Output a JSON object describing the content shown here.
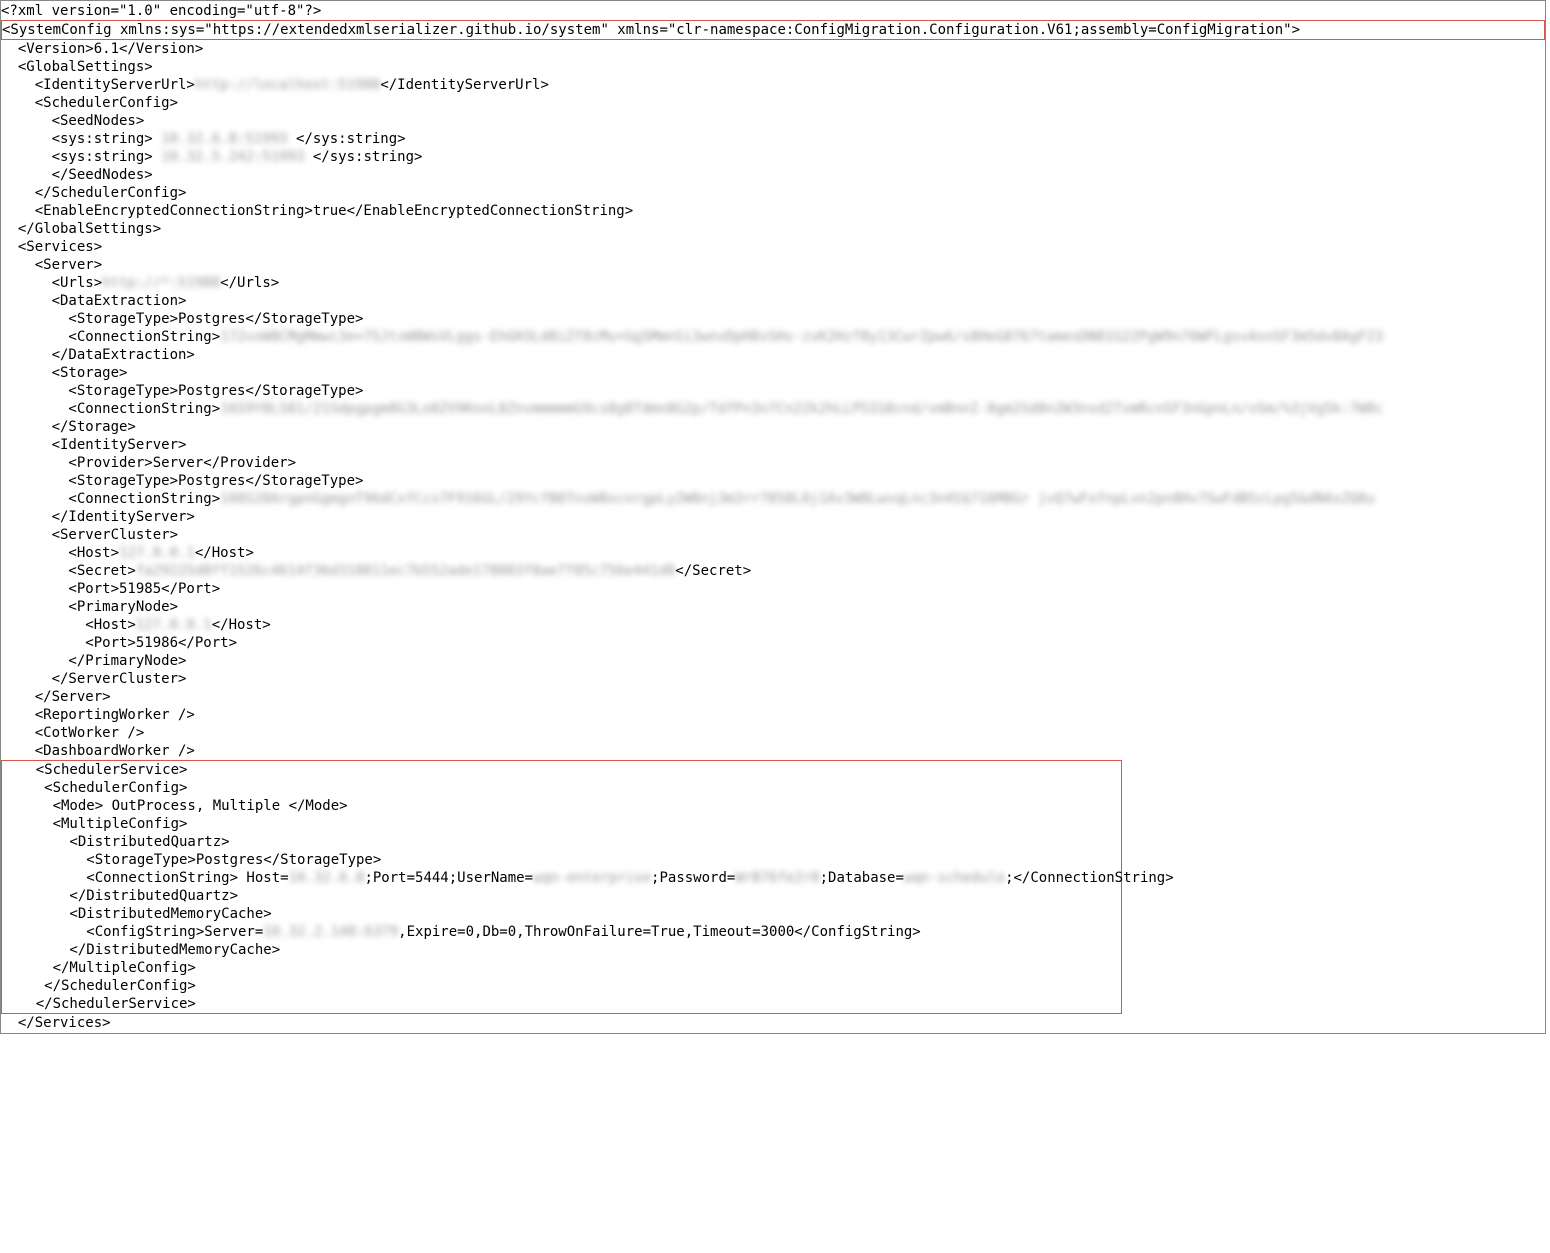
{
  "xml": {
    "l1": "<?xml version=\"1.0\" encoding=\"utf-8\"?>",
    "l2": "<SystemConfig xmlns:sys=\"https://extendedxmlserializer.github.io/system\" xmlns=\"clr-namespace:ConfigMigration.Configuration.V61;assembly=ConfigMigration\">",
    "l3": "  <Version>6.1</Version>",
    "l4": "  <GlobalSettings>",
    "l5a": "    <IdentityServerUrl>",
    "l5blur": "http://localhost:51988",
    "l5b": "</IdentityServerUrl>",
    "l6": "    <SchedulerConfig>",
    "l7": "      <SeedNodes>",
    "l8a": "      <sys:string> ",
    "l8blur": "10.32.6.8:51993",
    "l8b": " </sys:string>",
    "l9a": "      <sys:string> ",
    "l9blur": "10.32.5.242:51993",
    "l9b": " </sys:string>",
    "l10": "      </SeedNodes>",
    "l11": "    </SchedulerConfig>",
    "l12": "    <EnableEncryptedConnectionString>true</EnableEncryptedConnectionString>",
    "l13": "  </GlobalSettings>",
    "l14": "  <Services>",
    "l15": "    <Server>",
    "l16a": "      <Urls>",
    "l16blur": "http://*:51988",
    "l16b": "</Urls>",
    "l17": "      <DataExtraction>",
    "l18": "        <StorageType>Postgres</StorageType>",
    "l19a": "        <ConnectionString>",
    "l19blur": "172vxW8CMgMmwc3e=75JtxW8WsVLggs-EhGH3Ld8iZf8cMu+GgSMmnSi3wnvDpH8vSHs-zvK2Hzf8y13CwrZpw6/s8HeG8767tamesDN81G22PgW9n76WFLgsvAxnSF3m5dv8AgF23",
    "l20": "      </DataExtraction>",
    "l21": "      <Storage>",
    "l22": "        <StorageType>Postgres</StorageType>",
    "l23a": "        <ConnectionString>",
    "l23blur": "16S9Y8LS81/21Sdpgpgm8G3Lo8ZV9KnnL8ZnvmmmmmG9cs8g8Tdmn8G2p/TdfPn3n7Cn22k2hLLP5IG8cnd/vmBnnI-8gm2Sd8n2W3nsd2TvmRcnSF3nGpnLn/vSm/%3jVg5k:7W8c",
    "l24": "      </Storage>",
    "l25": "      <IdentityServer>",
    "l26": "        <Provider>Server</Provider>",
    "l27": "        <StorageType>Postgres</StorageType>",
    "l28a": "        <ConnectionString>",
    "l28blur": "108S28ArgpnGgmgnT96dCxfCcs7F916GL/29YcfB8TnsW8xcnrgpLy2W8nj3m3rr7858L0j1Av3W8LwvqLnc3n4S$716M8Gr jvQ7wFofnpLvn2pn8Hv7SwFdBScLpg5&dNAxZQ8u",
    "l29": "      </IdentityServer>",
    "l30": "      <ServerCluster>",
    "l31a": "        <Host>",
    "l31blur": "127.0.0.1",
    "l31b": "</Host>",
    "l32a": "        <Secret>",
    "l32blur": "fa29225d8ff1526c4614f36d318811ec7b552ade178883f8ae7f85c756e441d8",
    "l32b": "</Secret>",
    "l33": "        <Port>51985</Port>",
    "l34": "        <PrimaryNode>",
    "l35a": "          <Host>",
    "l35blur": "127.0.0.1",
    "l35b": "</Host>",
    "l36": "          <Port>51986</Port>",
    "l37": "        </PrimaryNode>",
    "l38": "      </ServerCluster>",
    "l39": "    </Server>",
    "l40": "    <ReportingWorker />",
    "l41": "    <CotWorker />",
    "l42": "    <DashboardWorker />",
    "l43": "    <SchedulerService>",
    "l44": "     <SchedulerConfig>",
    "l45": "      <Mode> OutProcess, Multiple </Mode>",
    "l46": "      <MultipleConfig>",
    "l47": "        <DistributedQuartz>",
    "l48": "          <StorageType>Postgres</StorageType>",
    "l49a": "          <ConnectionString> Host=",
    "l49b1": "10.32.6.8",
    "l49c": ";Port=5444;UserName=",
    "l49b2": "wqn-enterprise",
    "l49d": ";Password=",
    "l49b3": "WrB76fe2r8",
    "l49e": ";Database=",
    "l49b4": "wqn-schedule",
    "l49f": ";</ConnectionString>",
    "l50": "        </DistributedQuartz>",
    "l51": "        <DistributedMemoryCache>",
    "l52a": "          <ConfigString>Server=",
    "l52blur": "10.32.2.148:6379",
    "l52b": ",Expire=0,Db=0,ThrowOnFailure=True,Timeout=3000</ConfigString>",
    "l53": "        </DistributedMemoryCache>",
    "l54": "      </MultipleConfig>",
    "l55": "     </SchedulerConfig>",
    "l56": "    </SchedulerService>",
    "l57": "  </Services>"
  }
}
